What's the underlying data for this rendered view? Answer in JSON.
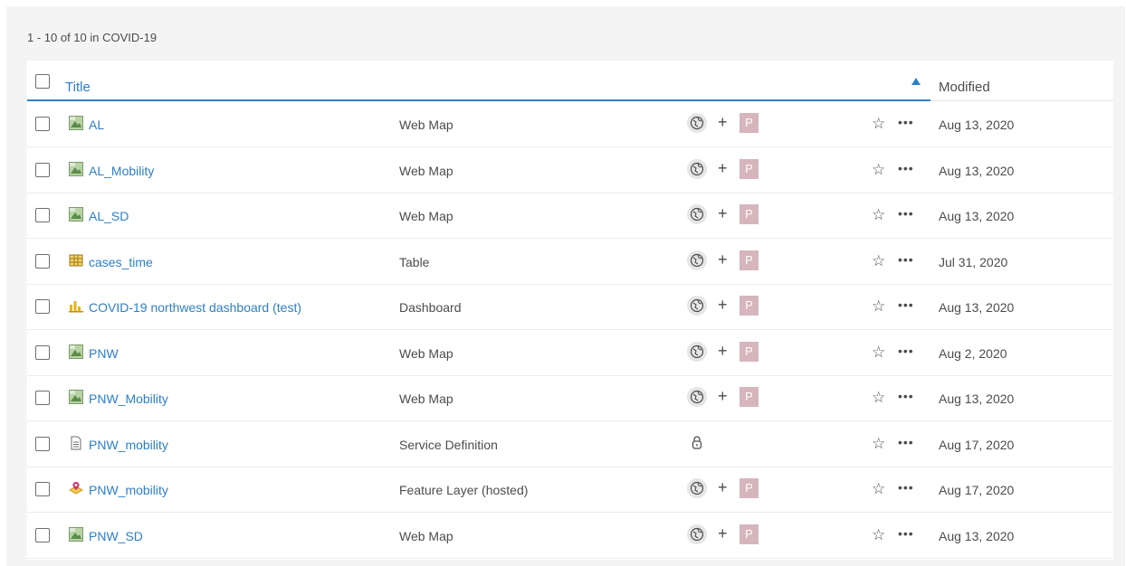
{
  "summary": "1 - 10 of 10 in COVID-19",
  "header": {
    "title": "Title",
    "modified": "Modified"
  },
  "colors": {
    "link": "#2d7fc7",
    "badge": "#d6b5bd"
  },
  "rows": [
    {
      "title": "AL",
      "type": "Web Map",
      "icon": "web-map-icon",
      "share": "public",
      "badge": "P",
      "modified": "Aug 13, 2020"
    },
    {
      "title": "AL_Mobility",
      "type": "Web Map",
      "icon": "web-map-icon",
      "share": "public",
      "badge": "P",
      "modified": "Aug 13, 2020"
    },
    {
      "title": "AL_SD",
      "type": "Web Map",
      "icon": "web-map-icon",
      "share": "public",
      "badge": "P",
      "modified": "Aug 13, 2020"
    },
    {
      "title": "cases_time",
      "type": "Table",
      "icon": "table-icon",
      "share": "public",
      "badge": "P",
      "modified": "Jul 31, 2020"
    },
    {
      "title": "COVID-19 northwest dashboard (test)",
      "type": "Dashboard",
      "icon": "dashboard-icon",
      "share": "public",
      "badge": "P",
      "modified": "Aug 13, 2020"
    },
    {
      "title": "PNW",
      "type": "Web Map",
      "icon": "web-map-icon",
      "share": "public",
      "badge": "P",
      "modified": "Aug 2, 2020"
    },
    {
      "title": "PNW_Mobility",
      "type": "Web Map",
      "icon": "web-map-icon",
      "share": "public",
      "badge": "P",
      "modified": "Aug 13, 2020"
    },
    {
      "title": "PNW_mobility",
      "type": "Service Definition",
      "icon": "document-icon",
      "share": "private",
      "badge": "",
      "modified": "Aug 17, 2020"
    },
    {
      "title": "PNW_mobility",
      "type": "Feature Layer (hosted)",
      "icon": "feature-layer-icon",
      "share": "public",
      "badge": "P",
      "modified": "Aug 17, 2020"
    },
    {
      "title": "PNW_SD",
      "type": "Web Map",
      "icon": "web-map-icon",
      "share": "public",
      "badge": "P",
      "modified": "Aug 13, 2020"
    }
  ]
}
